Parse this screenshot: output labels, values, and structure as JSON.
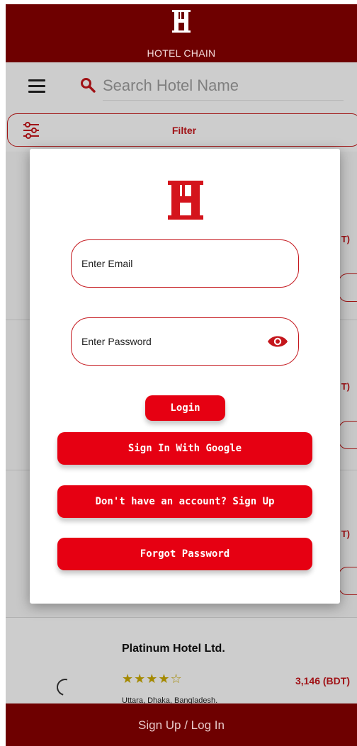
{
  "app": {
    "brand_title": "HOTEL CHAIN",
    "brand_color": "#6e0000",
    "accent_color": "#e60012"
  },
  "search": {
    "placeholder": "Search Hotel Name"
  },
  "filter": {
    "label": "Filter"
  },
  "background_cards": {
    "price_peeks": [
      "T)",
      "T)",
      "T)"
    ]
  },
  "hotel": {
    "name": "Platinum Hotel Ltd.",
    "stars": "★★★★☆",
    "rating": 4,
    "rating_max": 5,
    "price": "3,146 (BDT)",
    "location": "Uttara, Dhaka, Bangladesh."
  },
  "bottom_bar": {
    "label": "Sign Up / Log In"
  },
  "login_dialog": {
    "email_placeholder": "Enter Email",
    "password_placeholder": "Enter Password",
    "login_label": "Login",
    "google_label": "Sign In With Google",
    "signup_label": "Don't have an account? Sign Up",
    "forgot_label": "Forgot Password"
  },
  "icons": {
    "menu": "menu-icon",
    "search": "search-icon",
    "filter": "sliders-icon",
    "eye": "eye-icon",
    "logo": "hotel-chain-logo"
  }
}
